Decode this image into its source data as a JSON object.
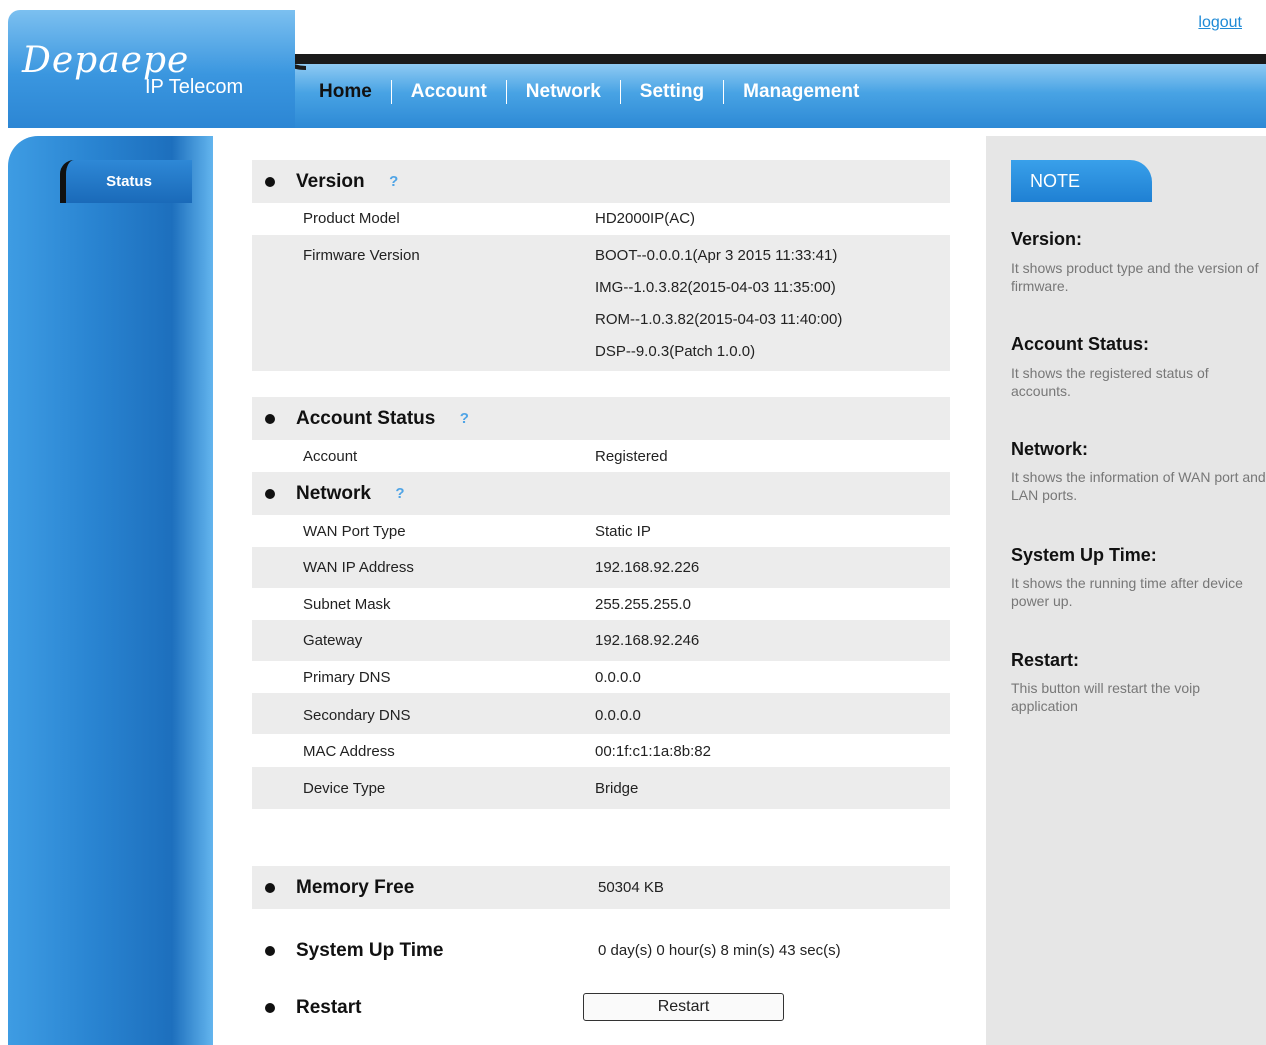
{
  "header": {
    "logout": "logout",
    "logo": "Depaepe",
    "logo_sub": "IP Telecom",
    "nav": [
      "Home",
      "Account",
      "Network",
      "Setting",
      "Management"
    ]
  },
  "sidebar": {
    "status": "Status"
  },
  "version": {
    "title": "Version",
    "product_model_label": "Product Model",
    "product_model": "HD2000IP(AC)",
    "firmware_label": "Firmware Version",
    "firmware": [
      "BOOT--0.0.0.1(Apr 3 2015 11:33:41)",
      "IMG--1.0.3.82(2015-04-03 11:35:00)",
      "ROM--1.0.3.82(2015-04-03 11:40:00)",
      "DSP--9.0.3(Patch 1.0.0)"
    ]
  },
  "account_status": {
    "title": "Account Status",
    "account_label": "Account",
    "account_value": "Registered"
  },
  "network": {
    "title": "Network",
    "rows": [
      {
        "label": "WAN Port Type",
        "value": "Static IP"
      },
      {
        "label": "WAN IP Address",
        "value": "192.168.92.226"
      },
      {
        "label": "Subnet Mask",
        "value": "255.255.255.0"
      },
      {
        "label": "Gateway",
        "value": "192.168.92.246"
      },
      {
        "label": "Primary DNS",
        "value": "0.0.0.0"
      },
      {
        "label": "Secondary DNS",
        "value": "0.0.0.0"
      },
      {
        "label": "MAC Address",
        "value": "00:1f:c1:1a:8b:82"
      },
      {
        "label": "Device Type",
        "value": "Bridge"
      }
    ]
  },
  "memory": {
    "title": "Memory Free",
    "value": "50304 KB"
  },
  "uptime": {
    "title": "System Up Time",
    "value": "0 day(s) 0 hour(s) 8 min(s) 43 sec(s)"
  },
  "restart": {
    "title": "Restart",
    "button": "Restart"
  },
  "note": {
    "tab": "NOTE",
    "items": [
      {
        "title": "Version:",
        "text": "It shows product type and the version of firmware."
      },
      {
        "title": "Account Status:",
        "text": "It shows the registered status of accounts."
      },
      {
        "title": "Network:",
        "text": "It shows the information of WAN port and LAN ports."
      },
      {
        "title": "System Up Time:",
        "text": "It shows the running time after device power up."
      },
      {
        "title": "Restart:",
        "text": "This button will restart the voip application"
      }
    ]
  }
}
